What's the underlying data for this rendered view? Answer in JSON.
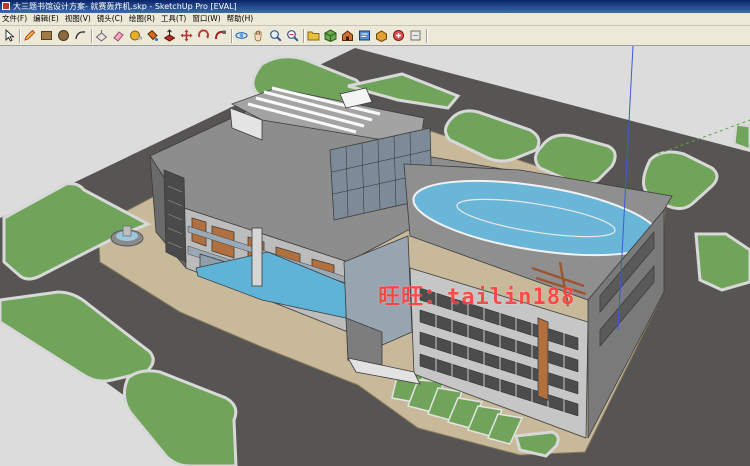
{
  "window": {
    "title": "大三题书馆设计方案- 就赛轰炸机.skp - SketchUp Pro [EVAL]"
  },
  "menu": {
    "items": [
      "文件(F)",
      "编辑(E)",
      "视图(V)",
      "镜头(C)",
      "绘图(R)",
      "工具(T)",
      "窗口(W)",
      "帮助(H)"
    ]
  },
  "toolbar": {
    "tools": [
      {
        "name": "select-tool-icon",
        "color": "#222222"
      },
      {
        "name": "pencil-tool-icon",
        "color": "#c0392b"
      },
      {
        "name": "rectangle-tool-icon",
        "color": "#7a5a32"
      },
      {
        "name": "circle-tool-icon",
        "color": "#6b4e2e"
      },
      {
        "name": "arc-tool-icon",
        "color": "#333333"
      },
      {
        "name": "push-pull-tool-icon",
        "color": "#b0b0b0"
      },
      {
        "name": "eraser-tool-icon",
        "color": "#e48fb0"
      },
      {
        "name": "tape-measure-tool-icon",
        "color": "#e0a020"
      },
      {
        "name": "paint-bucket-tool-icon",
        "color": "#d46a1c"
      },
      {
        "name": "push-pull-red-icon",
        "color": "#b03020"
      },
      {
        "name": "move-tool-icon",
        "color": "#c03030"
      },
      {
        "name": "rotate-tool-icon",
        "color": "#c03030"
      },
      {
        "name": "follow-me-tool-icon",
        "color": "#a02020"
      },
      {
        "name": "orbit-tool-icon",
        "color": "#2a6cc0"
      },
      {
        "name": "pan-tool-icon",
        "color": "#8a6c40"
      },
      {
        "name": "zoom-tool-icon",
        "color": "#335588"
      },
      {
        "name": "zoom-extents-tool-icon",
        "color": "#335588"
      },
      {
        "name": "folder-icon",
        "color": "#e8c040"
      },
      {
        "name": "components-icon",
        "color": "#4a8a3a"
      },
      {
        "name": "3d-warehouse-icon",
        "color": "#b05020"
      },
      {
        "name": "send-to-layout-icon",
        "color": "#3a6ab0"
      },
      {
        "name": "get-models-icon",
        "color": "#d09020"
      },
      {
        "name": "share-model-icon",
        "color": "#d03a3a"
      },
      {
        "name": "extension-warehouse-icon",
        "color": "#c0c0c0"
      }
    ]
  },
  "scene": {
    "watermark": "旺旺：tailin188",
    "colors": {
      "ground": "#dcdcdc",
      "road": "#575553",
      "grass": "#6fa45a",
      "paving": "#c9b99b",
      "roof": "#8d8d8d",
      "facade": "#c8c8c8",
      "wood": "#b2703e",
      "water": "#5fb3d6",
      "glass": "#9aa9b5"
    }
  }
}
